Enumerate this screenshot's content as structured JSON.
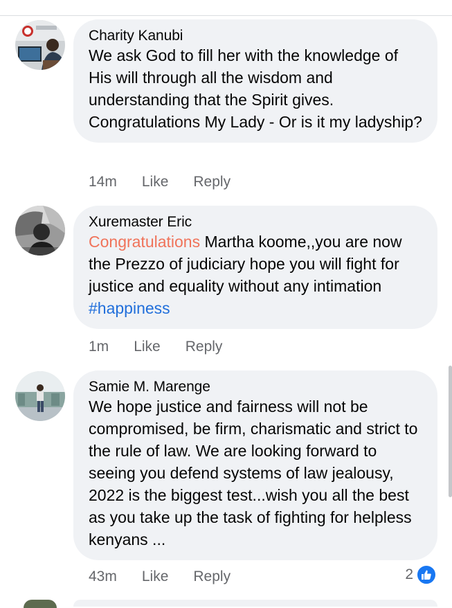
{
  "comments": [
    {
      "author": "Charity Kanubi",
      "text": "We ask God to fill her with the knowledge of His will through all the wisdom and understanding that the Spirit gives. Congratulations My Lady - Or is it my ladyship?",
      "time": "14m",
      "like_label": "Like",
      "reply_label": "Reply"
    },
    {
      "author": "Xuremaster Eric",
      "mention": "Congratulations",
      "text": " Martha koome,,you are now the Prezzo of judiciary hope you will fight for justice and equality without any intimation ",
      "hashtag": "#happiness",
      "time": "1m",
      "like_label": "Like",
      "reply_label": "Reply"
    },
    {
      "author": "Samie M. Marenge",
      "text": "We hope justice and fairness will not be compromised,  be firm, charismatic and strict to the rule of law. We are looking forward to seeing you defend systems of law jealousy, 2022 is the biggest test...wish you all the best as you take up the task of fighting for helpless kenyans ...",
      "time": "43m",
      "like_label": "Like",
      "reply_label": "Reply",
      "reaction_count": "2"
    }
  ],
  "icons": {
    "like_reaction": "like-thumb-icon"
  },
  "colors": {
    "bubble_bg": "#f0f2f5",
    "mention": "#f0735a",
    "hashtag": "#216fdb",
    "like_blue": "#1877f2",
    "meta_gray": "#65676b"
  }
}
